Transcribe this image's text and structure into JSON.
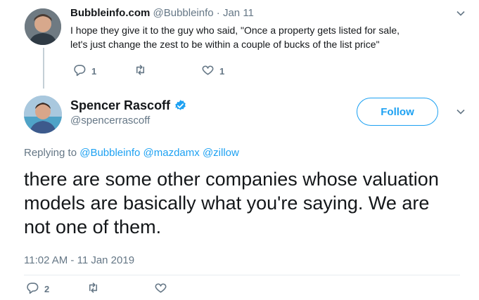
{
  "reply_tweet": {
    "display_name": "Bubbleinfo.com",
    "handle": "@Bubbleinfo",
    "separator": "·",
    "date": "Jan 11",
    "text": "I hope they give it to the guy who said, \"Once a property gets listed for sale, let's just change the zest to be within a couple of bucks of the list price\"",
    "reply_count": "1",
    "retweet_count": "",
    "like_count": "1"
  },
  "main_tweet": {
    "display_name": "Spencer Rascoff",
    "handle": "@spencerrascoff",
    "follow_label": "Follow",
    "replying_prefix": "Replying to",
    "replying_to": [
      "@Bubbleinfo",
      "@mazdamx",
      "@zillow"
    ],
    "text": "there are some other companies whose valuation models are basically what you're saying. We are not one of them.",
    "timestamp": "11:02 AM - 11 Jan 2019",
    "reply_count": "2",
    "retweet_count": "",
    "like_count": ""
  },
  "colors": {
    "accent": "#1da1f2",
    "muted": "#657786",
    "text": "#14171a"
  },
  "icons": [
    "reply-icon",
    "retweet-icon",
    "like-icon",
    "chevron-down-icon",
    "verified-badge-icon"
  ]
}
